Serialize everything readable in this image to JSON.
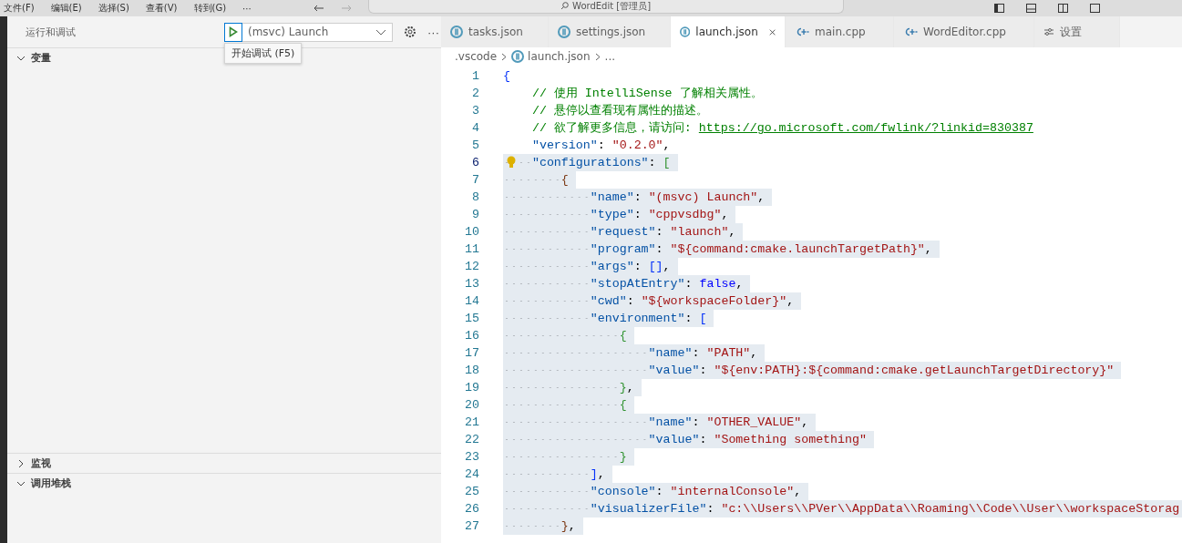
{
  "menu_bar": {
    "items": [
      "文件(F)",
      "编辑(E)",
      "选择(S)",
      "查看(V)",
      "转到(G)",
      "···"
    ],
    "search": {
      "value": "WordEdit [管理员]"
    }
  },
  "sidebar": {
    "title": "运行和调试",
    "launch_config": "(msvc) Launch",
    "more": "···",
    "tooltip": "开始调试 (F5)",
    "sections": [
      {
        "title": "变量",
        "expanded": true
      },
      {
        "title": "监视",
        "expanded": false
      },
      {
        "title": "调用堆栈",
        "expanded": true
      }
    ]
  },
  "tabs": [
    {
      "label": "tasks.json",
      "kind": "json",
      "selected": false
    },
    {
      "label": "settings.json",
      "kind": "json",
      "selected": false
    },
    {
      "label": "launch.json",
      "kind": "json",
      "selected": true
    },
    {
      "label": "main.cpp",
      "kind": "cpp",
      "selected": false
    },
    {
      "label": "WordEditor.cpp",
      "kind": "cpp",
      "selected": false
    },
    {
      "label": "设置",
      "kind": "settings",
      "selected": false
    }
  ],
  "breadcrumb": [
    ".vscode",
    "launch.json",
    "..."
  ],
  "code_lines": [
    {
      "number": "1",
      "selected": false,
      "tokens": [
        {
          "kind": "level1",
          "text": "{"
        }
      ]
    },
    {
      "number": "2",
      "selected": false,
      "tokens": [
        {
          "kind": "comment",
          "text": "    // 使用 IntelliSense 了解相关属性。"
        }
      ]
    },
    {
      "number": "3",
      "selected": false,
      "tokens": [
        {
          "kind": "comment",
          "text": "    // 悬停以查看现有属性的描述。"
        }
      ]
    },
    {
      "number": "4",
      "selected": false,
      "tokens": [
        {
          "kind": "comment",
          "text": "    // 欲了解更多信息，请访问: "
        },
        {
          "kind": "link",
          "text": "https://go.microsoft.com/fwlink/?linkid=830387"
        }
      ]
    },
    {
      "number": "5",
      "selected": false,
      "tokens": [
        {
          "kind": "key",
          "text": "    \"version\""
        },
        {
          "kind": "punct",
          "text": ": "
        },
        {
          "kind": "string",
          "text": "\"0.2.0\""
        },
        {
          "kind": "punct",
          "text": ","
        }
      ]
    },
    {
      "number": "6",
      "selected": true,
      "lightbulb": true,
      "tokens": [
        {
          "kind": "key",
          "text": "    \"configurations\""
        },
        {
          "kind": "punct",
          "text": ": "
        },
        {
          "kind": "level2",
          "text": "["
        }
      ]
    },
    {
      "number": "7",
      "selected": true,
      "tokens": [
        {
          "kind": "level3",
          "text": "        {"
        }
      ]
    },
    {
      "number": "8",
      "selected": true,
      "tokens": [
        {
          "kind": "key",
          "text": "            \"name\""
        },
        {
          "kind": "punct",
          "text": ": "
        },
        {
          "kind": "string",
          "text": "\"(msvc) Launch\""
        },
        {
          "kind": "punct",
          "text": ","
        }
      ]
    },
    {
      "number": "9",
      "selected": true,
      "tokens": [
        {
          "kind": "key",
          "text": "            \"type\""
        },
        {
          "kind": "punct",
          "text": ": "
        },
        {
          "kind": "string",
          "text": "\"cppvsdbg\""
        },
        {
          "kind": "punct",
          "text": ","
        }
      ]
    },
    {
      "number": "10",
      "selected": true,
      "tokens": [
        {
          "kind": "key",
          "text": "            \"request\""
        },
        {
          "kind": "punct",
          "text": ": "
        },
        {
          "kind": "string",
          "text": "\"launch\""
        },
        {
          "kind": "punct",
          "text": ","
        }
      ]
    },
    {
      "number": "11",
      "selected": true,
      "tokens": [
        {
          "kind": "key",
          "text": "            \"program\""
        },
        {
          "kind": "punct",
          "text": ": "
        },
        {
          "kind": "string",
          "text": "\"${command:cmake.launchTargetPath}\""
        },
        {
          "kind": "punct",
          "text": ","
        }
      ]
    },
    {
      "number": "12",
      "selected": true,
      "tokens": [
        {
          "kind": "key",
          "text": "            \"args\""
        },
        {
          "kind": "punct",
          "text": ": "
        },
        {
          "kind": "level1",
          "text": "[]"
        },
        {
          "kind": "punct",
          "text": ","
        }
      ]
    },
    {
      "number": "13",
      "selected": true,
      "tokens": [
        {
          "kind": "key",
          "text": "            \"stopAtEntry\""
        },
        {
          "kind": "punct",
          "text": ": "
        },
        {
          "kind": "keyword",
          "text": "false"
        },
        {
          "kind": "punct",
          "text": ","
        }
      ]
    },
    {
      "number": "14",
      "selected": true,
      "tokens": [
        {
          "kind": "key",
          "text": "            \"cwd\""
        },
        {
          "kind": "punct",
          "text": ": "
        },
        {
          "kind": "string",
          "text": "\"${workspaceFolder}\""
        },
        {
          "kind": "punct",
          "text": ","
        }
      ]
    },
    {
      "number": "15",
      "selected": true,
      "tokens": [
        {
          "kind": "key",
          "text": "            \"environment\""
        },
        {
          "kind": "punct",
          "text": ": "
        },
        {
          "kind": "level1",
          "text": "["
        }
      ]
    },
    {
      "number": "16",
      "selected": true,
      "tokens": [
        {
          "kind": "level2",
          "text": "                {"
        }
      ]
    },
    {
      "number": "17",
      "selected": true,
      "tokens": [
        {
          "kind": "key",
          "text": "                    \"name\""
        },
        {
          "kind": "punct",
          "text": ": "
        },
        {
          "kind": "string",
          "text": "\"PATH\""
        },
        {
          "kind": "punct",
          "text": ","
        }
      ]
    },
    {
      "number": "18",
      "selected": true,
      "tokens": [
        {
          "kind": "key",
          "text": "                    \"value\""
        },
        {
          "kind": "punct",
          "text": ": "
        },
        {
          "kind": "string",
          "text": "\"${env:PATH}:${command:cmake.getLaunchTargetDirectory}\""
        }
      ]
    },
    {
      "number": "19",
      "selected": true,
      "tokens": [
        {
          "kind": "level2",
          "text": "                }"
        },
        {
          "kind": "punct",
          "text": ","
        }
      ]
    },
    {
      "number": "20",
      "selected": true,
      "tokens": [
        {
          "kind": "level2",
          "text": "                {"
        }
      ]
    },
    {
      "number": "21",
      "selected": true,
      "tokens": [
        {
          "kind": "key",
          "text": "                    \"name\""
        },
        {
          "kind": "punct",
          "text": ": "
        },
        {
          "kind": "string",
          "text": "\"OTHER_VALUE\""
        },
        {
          "kind": "punct",
          "text": ","
        }
      ]
    },
    {
      "number": "22",
      "selected": true,
      "tokens": [
        {
          "kind": "key",
          "text": "                    \"value\""
        },
        {
          "kind": "punct",
          "text": ": "
        },
        {
          "kind": "string",
          "text": "\"Something something\""
        }
      ]
    },
    {
      "number": "23",
      "selected": true,
      "tokens": [
        {
          "kind": "level2",
          "text": "                }"
        }
      ]
    },
    {
      "number": "24",
      "selected": true,
      "tokens": [
        {
          "kind": "level1",
          "text": "            ]"
        },
        {
          "kind": "punct",
          "text": ","
        }
      ]
    },
    {
      "number": "25",
      "selected": true,
      "tokens": [
        {
          "kind": "key",
          "text": "            \"console\""
        },
        {
          "kind": "punct",
          "text": ": "
        },
        {
          "kind": "string",
          "text": "\"internalConsole\""
        },
        {
          "kind": "punct",
          "text": ","
        }
      ]
    },
    {
      "number": "26",
      "selected": true,
      "tokens": [
        {
          "kind": "key",
          "text": "            \"visualizerFile\""
        },
        {
          "kind": "punct",
          "text": ": "
        },
        {
          "kind": "string",
          "text": "\"c:\\\\Users\\\\PVer\\\\AppData\\\\Roaming\\\\Code\\\\User\\\\workspaceStorag"
        }
      ]
    },
    {
      "number": "27",
      "selected": true,
      "tokens": [
        {
          "kind": "level3",
          "text": "        }"
        },
        {
          "kind": "punct",
          "text": ","
        }
      ]
    }
  ]
}
